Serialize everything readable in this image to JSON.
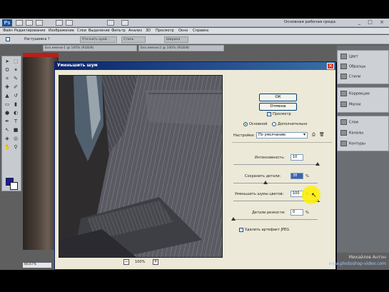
{
  "app": {
    "logo": "Ps",
    "workspace": "Основная рабочая среда",
    "window_controls": "_ □ ×"
  },
  "menu": {
    "items": [
      "Файл",
      "Редактирование",
      "Изображение",
      "Слои",
      "Выделение",
      "Фильтр",
      "Анализ",
      "3D",
      "Просмотр",
      "Окно",
      "Справка"
    ]
  },
  "options": {
    "label": "Растушевка ?",
    "tab_1": "Уточнить край...",
    "tab_2": "Стиль",
    "tab_3": "Ширина"
  },
  "doc_tabs": [
    "Без имени-1 @ 100% (RGB/8)",
    "Без имени-2 @ 100% (RGB/8)"
  ],
  "dialog": {
    "title": "Уменьшить шум",
    "ok_label": "ОК",
    "cancel_label": "Отмена",
    "preview_label": "Просмотр",
    "mode_basic": "Основной",
    "mode_advanced": "Дополнительно",
    "settings_label": "Настройки:",
    "settings_value": "По умолчанию",
    "strength_label": "Интенсивность:",
    "strength_value": "10",
    "preserve_label": "Сохранить детали:",
    "preserve_value": "38",
    "reduce_color_label": "Уменьшить шумы цветов:",
    "reduce_color_value": "100",
    "sharpen_label": "Детали резкости:",
    "sharpen_value": "0",
    "jpeg_label": "Удалить артефакт JPEG",
    "zoom_value": "100%",
    "zoom_minus": "−",
    "zoom_plus": "+",
    "percent": "%",
    "slider_levels": {
      "strength": 1.0,
      "preserve": 0.38,
      "reduce_color": 1.0,
      "sharpen": 0.0
    }
  },
  "right_panel": {
    "group1": [
      "Цвет",
      "Образцы",
      "Стили"
    ],
    "group2": [
      "Коррекция",
      "Маски"
    ],
    "group3": [
      "Слои",
      "Каналы",
      "Контуры"
    ]
  },
  "status": {
    "zoom": "66,67%"
  },
  "watermark": {
    "author": "Михайлов Антон",
    "url": "www.photoshop-video.com"
  },
  "colors": {
    "foreground": "#1a1aa8",
    "background": "#ffffff",
    "dialog_title": "#0a246a"
  }
}
